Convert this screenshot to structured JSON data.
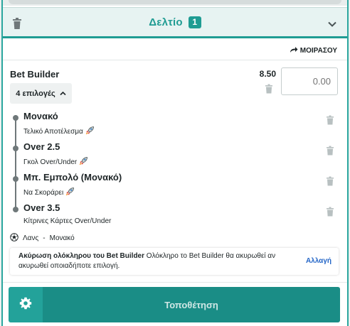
{
  "colors": {
    "accent": "#1f9c93",
    "link": "#2466c7",
    "text": "#1d2426",
    "muted": "#9aa4a6"
  },
  "header": {
    "title": "Δελτίο",
    "count": "1"
  },
  "share": {
    "label": "ΜΟΙΡΑΣΟΥ"
  },
  "bet_builder": {
    "title": "Bet Builder",
    "odds": "8.50",
    "stake_placeholder": "0.00",
    "selections_toggle": "4 επιλογές"
  },
  "legs": [
    {
      "name": "Μονακό",
      "market": "Τελικό Αποτέλεσμα",
      "boost": true
    },
    {
      "name": "Over 2.5",
      "market": "Γκολ Over/Under",
      "boost": true
    },
    {
      "name": "Μπ. Εμπολό (Μονακό)",
      "market": "Να Σκοράρει",
      "boost": true
    },
    {
      "name": "Over 3.5",
      "market": "Κίτρινες Κάρτες Over/Under",
      "boost": false
    }
  ],
  "match": {
    "home": "Λανς",
    "separator": "-",
    "away": "Μονακό"
  },
  "info": {
    "bold": "Ακύρωση ολόκληρου του Bet Builder",
    "text": " Ολόκληρο το Bet Builder θα ακυρωθεί αν ακυρωθεί οποιαδήποτε επιλογή.",
    "link": "Αλλαγή"
  },
  "footer": {
    "place_label": "Τοποθέτηση"
  },
  "icons": {
    "trash": "trash-icon",
    "chevron": "chevron-down-icon",
    "share": "share-arrow-icon",
    "gear": "gear-icon",
    "ball": "soccer-ball-icon",
    "rocket": "rocket-icon"
  }
}
